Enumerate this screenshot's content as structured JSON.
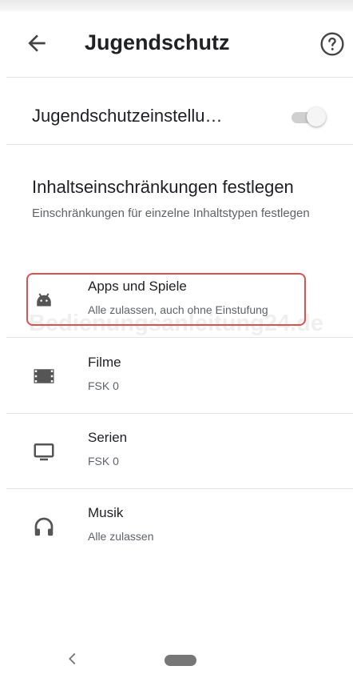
{
  "appbar": {
    "title": "Jugendschutz"
  },
  "parental_toggle": {
    "label": "Jugendschutzeinstellu…",
    "enabled": true
  },
  "content_restrictions": {
    "title": "Inhaltseinschränkungen festlegen",
    "subtitle": "Einschränkungen für einzelne Inhaltstypen festlegen"
  },
  "items": [
    {
      "label": "Apps und Spiele",
      "value": "Alle zulassen, auch ohne Einstufung",
      "icon": "android-icon"
    },
    {
      "label": "Filme",
      "value": "FSK 0",
      "icon": "film-icon"
    },
    {
      "label": "Serien",
      "value": "FSK 0",
      "icon": "tv-icon"
    },
    {
      "label": "Musik",
      "value": "Alle zulassen",
      "icon": "headphones-icon"
    }
  ],
  "watermark": "Bedienungsanleitung24.de",
  "colors": {
    "highlight": "#d9534f",
    "toggle_track": "#d0d0d0"
  }
}
